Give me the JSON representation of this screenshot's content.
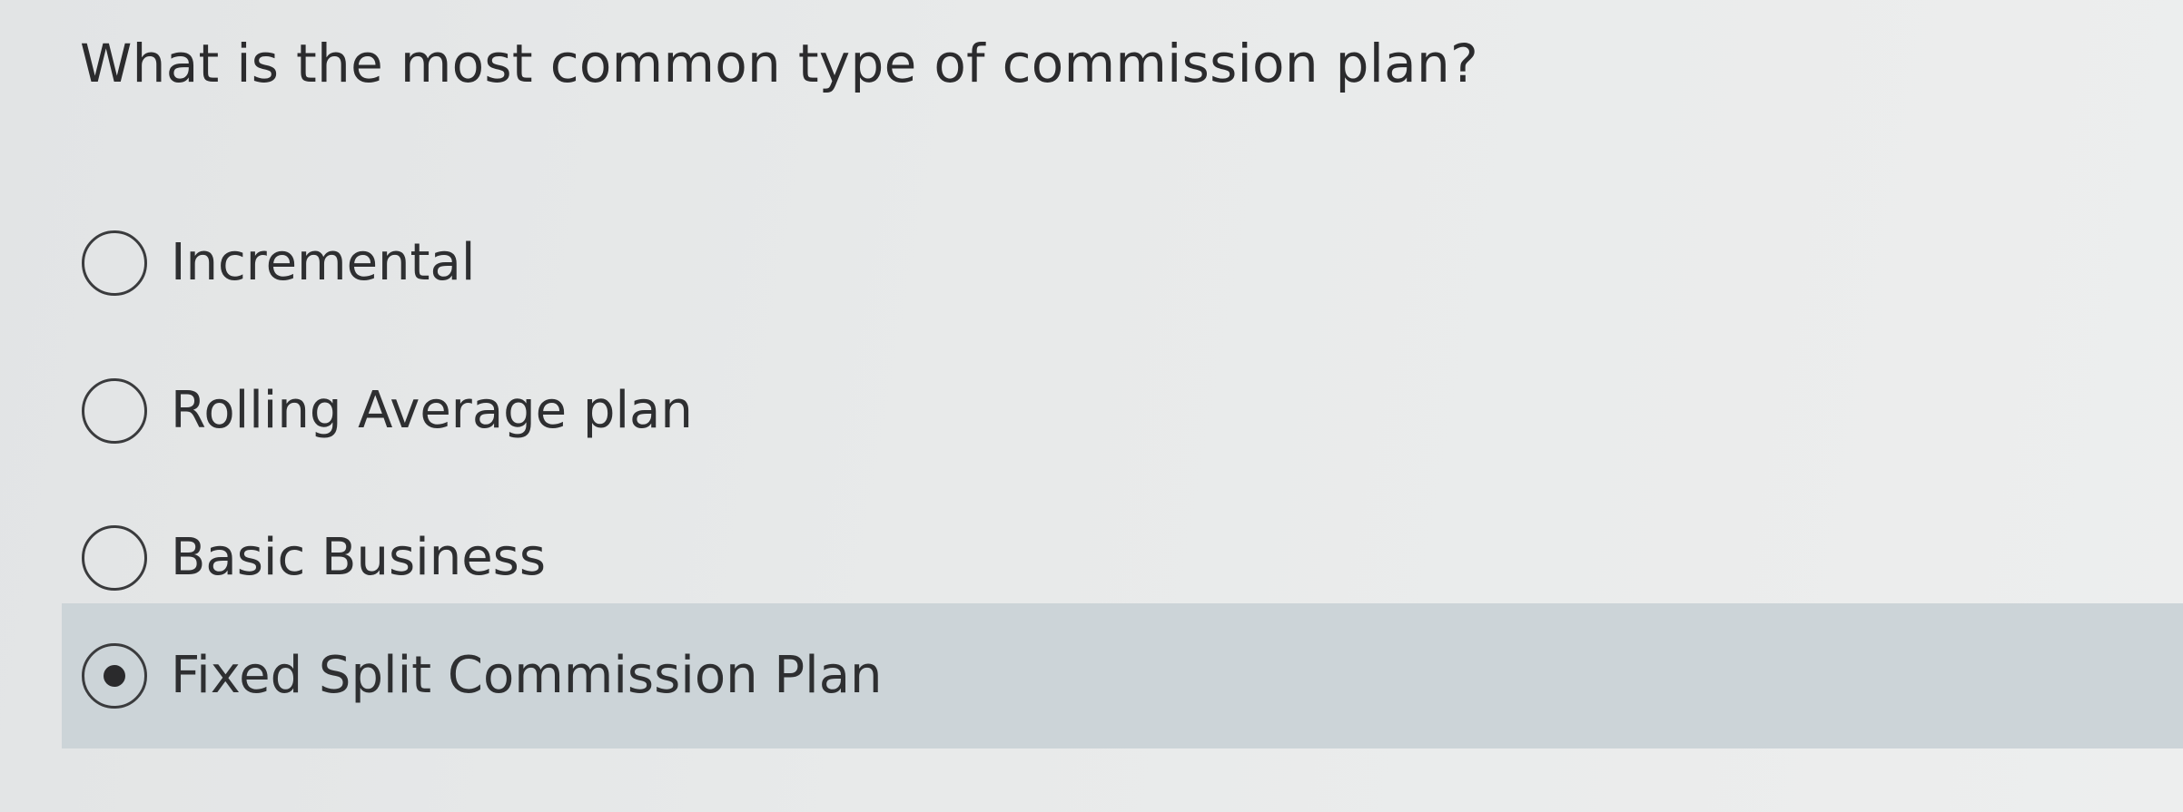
{
  "question": {
    "text": "What is the most common type of commission plan?"
  },
  "options": [
    {
      "label": "Incremental",
      "selected": false
    },
    {
      "label": "Rolling Average plan",
      "selected": false
    },
    {
      "label": "Basic Business",
      "selected": false
    },
    {
      "label": "Fixed Split Commission Plan",
      "selected": true
    }
  ]
}
